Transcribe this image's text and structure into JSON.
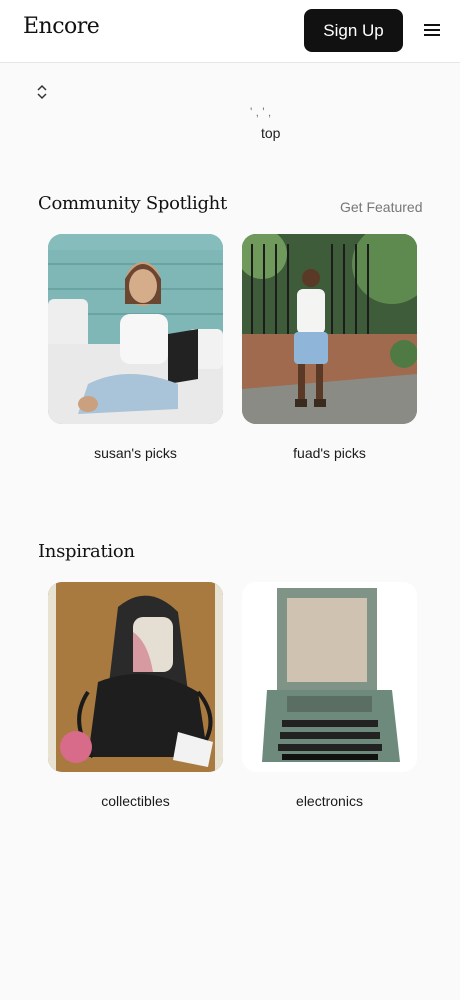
{
  "header": {
    "logo": "Encore",
    "signup_label": "Sign Up"
  },
  "partial": {
    "text": "' , ' ,",
    "top_label": "top"
  },
  "spotlight": {
    "title": "Community Spotlight",
    "action": "Get Featured",
    "cards": [
      {
        "label": "susan's picks"
      },
      {
        "label": "fuad's picks"
      }
    ]
  },
  "inspiration": {
    "title": "Inspiration",
    "cards": [
      {
        "label": "collectibles"
      },
      {
        "label": "electronics"
      }
    ]
  },
  "icons": {
    "menu": "hamburger-menu-icon",
    "sort": "sort-chevrons-icon"
  }
}
